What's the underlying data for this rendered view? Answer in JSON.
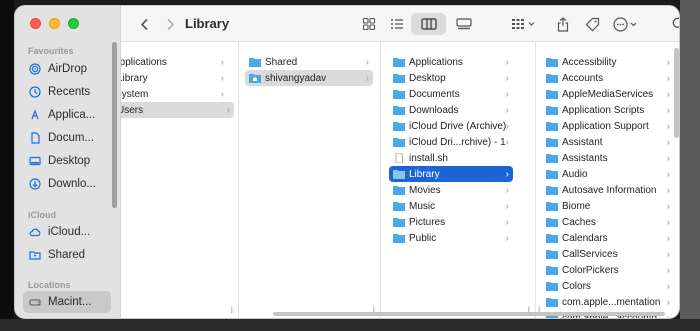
{
  "window": {
    "title": "Library"
  },
  "sidebar": {
    "favourites_label": "Favourites",
    "favourites": [
      {
        "label": "AirDrop",
        "icon": "airdrop-icon"
      },
      {
        "label": "Recents",
        "icon": "clock-icon"
      },
      {
        "label": "Applica...",
        "icon": "applications-icon"
      },
      {
        "label": "Docum...",
        "icon": "document-icon"
      },
      {
        "label": "Desktop",
        "icon": "desktop-icon"
      },
      {
        "label": "Downlo...",
        "icon": "download-icon"
      }
    ],
    "icloud_label": "iCloud",
    "icloud": [
      {
        "label": "iCloud...",
        "icon": "cloud-icon"
      },
      {
        "label": "Shared",
        "icon": "shared-folder-icon"
      }
    ],
    "locations_label": "Locations",
    "locations": [
      {
        "label": "Macint...",
        "icon": "disk-icon",
        "selected": true
      }
    ]
  },
  "columns": {
    "col1": [
      "Applications",
      "Library",
      "System",
      "Users"
    ],
    "col2": [
      "Shared",
      "shivangyadav"
    ],
    "col3": [
      "Applications",
      "Desktop",
      "Documents",
      "Downloads",
      "iCloud Drive (Archive)",
      "iCloud Dri...rchive) - 1",
      "install.sh",
      "Library",
      "Movies",
      "Music",
      "Pictures",
      "Public"
    ],
    "col4": [
      "Accessibility",
      "Accounts",
      "AppleMediaServices",
      "Application Scripts",
      "Application Support",
      "Assistant",
      "Assistants",
      "Audio",
      "Autosave Information",
      "Biome",
      "Caches",
      "Calendars",
      "CallServices",
      "ColorPickers",
      "Colors",
      "com.apple...mentation",
      "com.apple...accountd"
    ]
  },
  "colors": {
    "accent": "#1d65d6",
    "folder": "#4aa8e8"
  }
}
